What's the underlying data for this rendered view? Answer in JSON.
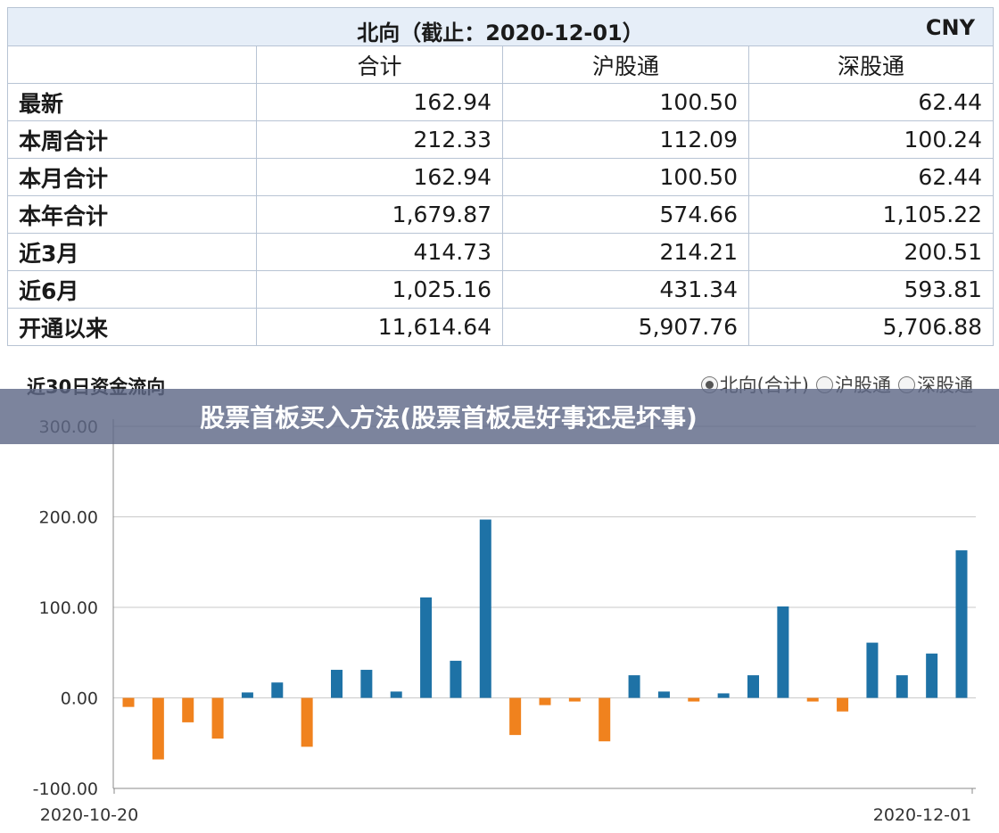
{
  "table": {
    "title": "北向（截止：2020-12-01）",
    "currency": "CNY",
    "columns": [
      "",
      "合计",
      "沪股通",
      "深股通"
    ],
    "rows": [
      {
        "label": "最新",
        "values": [
          "162.94",
          "100.50",
          "62.44"
        ]
      },
      {
        "label": "本周合计",
        "values": [
          "212.33",
          "112.09",
          "100.24"
        ]
      },
      {
        "label": "本月合计",
        "values": [
          "162.94",
          "100.50",
          "62.44"
        ]
      },
      {
        "label": "本年合计",
        "values": [
          "1,679.87",
          "574.66",
          "1,105.22"
        ]
      },
      {
        "label": "近3月",
        "values": [
          "414.73",
          "214.21",
          "200.51"
        ]
      },
      {
        "label": "近6月",
        "values": [
          "1,025.16",
          "431.34",
          "593.81"
        ]
      },
      {
        "label": "开通以来",
        "values": [
          "11,614.64",
          "5,907.76",
          "5,706.88"
        ]
      }
    ]
  },
  "chart_header": {
    "title": "近30日资金流向",
    "options": [
      {
        "label": "北向(合计)",
        "selected": true
      },
      {
        "label": "沪股通",
        "selected": false
      },
      {
        "label": "深股通",
        "selected": false
      }
    ]
  },
  "banner": {
    "text": "股票首板买入方法(股票首板是好事还是坏事)"
  },
  "chart_data": {
    "type": "bar",
    "title": "近30日资金流向",
    "xlabel": "",
    "ylabel": "",
    "ylim": [
      -100,
      300
    ],
    "y_ticks": [
      "300.00",
      "200.00",
      "100.00",
      "0.00",
      "-100.00"
    ],
    "x_tick_labels": [
      "2020-10-20",
      "2020-12-01"
    ],
    "positive_color": "#1e72a6",
    "negative_color": "#f0821e",
    "series": [
      {
        "values": [
          -10,
          -68,
          -27,
          -45,
          6,
          17,
          -54,
          31,
          31,
          7,
          111,
          41,
          197,
          -41,
          -8,
          -4,
          -48,
          25,
          7,
          -4,
          5,
          25,
          101,
          -4,
          -15,
          61,
          25,
          49,
          163
        ]
      }
    ]
  }
}
